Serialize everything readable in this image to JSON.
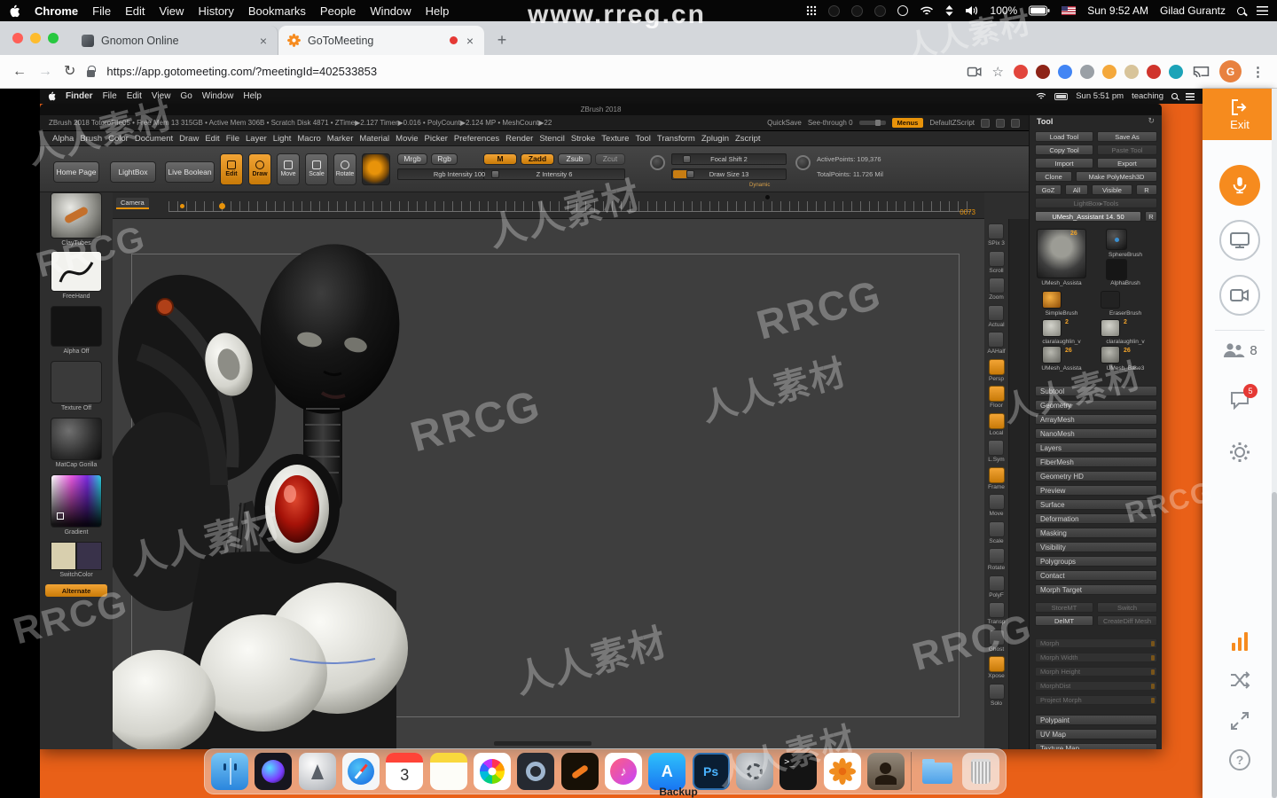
{
  "watermarks": [
    "www.rreg.cn",
    "人人素材",
    "人人素材",
    "RRCG",
    "人人素材",
    "RRCG",
    "人人素材",
    "RRCG",
    "人人素材",
    "RRCG",
    "人人素材",
    "RRCG",
    "人人素材",
    "RRCG",
    "人人素材"
  ],
  "macbar": {
    "app": "Chrome",
    "menus": [
      "File",
      "Edit",
      "View",
      "History",
      "Bookmarks",
      "People",
      "Window",
      "Help"
    ],
    "battery": "100%",
    "clock": "Sun 9:52 AM",
    "user": "Gilad Gurantz"
  },
  "browser": {
    "tab1": "Gnomon Online",
    "tab2": "GoToMeeting",
    "url": "https://app.gotomeeting.com/?meetingId=402533853",
    "avatar": "G",
    "icons": {
      "close": "×",
      "new_tab": "+",
      "back": "←",
      "forward": "→",
      "reload": "↻",
      "star": "☆",
      "menu": "⋮"
    },
    "ext_colors": [
      "#e2453c",
      "#8e2417",
      "#4285f4",
      "#9aa0a6",
      "#f4a83b",
      "#d8c49a",
      "#d0342c",
      "#1ca3b8"
    ]
  },
  "remote": {
    "bar": {
      "app": "Finder",
      "menus": [
        "File",
        "Edit",
        "View",
        "Go",
        "Window",
        "Help"
      ],
      "clock": "Sun 5:51 pm",
      "session": "teaching"
    },
    "desktop_label": "Backup",
    "dock_icons": [
      "finder",
      "siri",
      "launchpad",
      "safari",
      "calendar",
      "notes",
      "photos",
      "quicktime",
      "character-app",
      "itunes",
      "app-store",
      "photoshop",
      "system-preferences",
      "terminal",
      "zbrush",
      "zbrush-sculpt",
      "folder",
      "trash"
    ],
    "dock": {
      "calendar_day": "3",
      "photoshop": "Ps",
      "terminal": ">_",
      "appstore": "A",
      "itunes_glyph": "♪"
    }
  },
  "zbrush": {
    "title": "ZBrush 2018",
    "status_left": "ZBrush 2018 TotoroFile05 • Free Mem 13 315GB • Active Mem 306B • Scratch Disk 4871 • ZTime▶2.127 Timer▶0.016 • PolyCount▶2.124 MP • MeshCount▶22",
    "status_right": {
      "quicksave": "QuickSave",
      "see_through": "See-through 0",
      "menus": "Menus",
      "script": "DefaultZScript"
    },
    "menus": [
      "Alpha",
      "Brush",
      "Color",
      "Document",
      "Draw",
      "Edit",
      "File",
      "Layer",
      "Light",
      "Macro",
      "Marker",
      "Material",
      "Movie",
      "Picker",
      "Preferences",
      "Render",
      "Stencil",
      "Stroke",
      "Texture",
      "Tool",
      "Transform",
      "Zplugin",
      "Zscript"
    ],
    "shelf": {
      "home_page": "Home Page",
      "lightbox": "LightBox",
      "live_boolean": "Live Boolean",
      "edit": "Edit",
      "draw": "Draw",
      "move": "Move",
      "scale": "Scale",
      "rotate": "Rotate",
      "mrgb": "Mrgb",
      "rgb": "Rgb",
      "m": "M",
      "zadd": "Zadd",
      "zsub": "Zsub",
      "zcut": "Zcut",
      "rgb_intensity": "Rgb Intensity 100",
      "z_intensity": "Z Intensity 6",
      "focal_shift": "Focal Shift 2",
      "draw_size": "Draw Size 13",
      "dynamic": "Dynamic",
      "active_points": "ActivePoints: 109,376",
      "total_points": "TotalPoints: 11.726 Mil"
    },
    "timeline": {
      "camera": "Camera",
      "counter": "0073"
    },
    "left_panel": {
      "brush": "ClayTubes",
      "stroke": "FreeHand",
      "alpha": "Alpha Off",
      "texture": "Texture Off",
      "material": "MatCap Gorilla",
      "gradient": "Gradient",
      "switch_color": "SwitchColor",
      "alternate": "Alternate"
    },
    "right_strip": [
      {
        "label": "SPix 3",
        "active": false
      },
      {
        "label": "Scroll",
        "active": false
      },
      {
        "label": "Zoom",
        "active": false
      },
      {
        "label": "Actual",
        "active": false
      },
      {
        "label": "AAHalf",
        "active": false
      },
      {
        "label": "Persp",
        "active": true
      },
      {
        "label": "Floor",
        "active": true
      },
      {
        "label": "Local",
        "active": true
      },
      {
        "label": "L.Sym",
        "active": false
      },
      {
        "label": "Frame",
        "active": true
      },
      {
        "label": "Move",
        "active": false
      },
      {
        "label": "Scale",
        "active": false
      },
      {
        "label": "Rotate",
        "active": false
      },
      {
        "label": "PolyF",
        "active": false
      },
      {
        "label": "Transp",
        "active": false
      },
      {
        "label": "Ghost",
        "active": false
      },
      {
        "label": "Xpose",
        "active": true
      },
      {
        "label": "Solo",
        "active": false
      }
    ],
    "tool": {
      "title": "Tool",
      "load": "Load Tool",
      "save": "Save As",
      "copy": "Copy Tool",
      "paste": "Paste Tool",
      "import": "Import",
      "export": "Export",
      "clone": "Clone",
      "make_polymesh": "Make PolyMesh3D",
      "goz": "GoZ",
      "all": "All",
      "visible": "Visible",
      "r": "R",
      "lightbox_tools": "LightBox▸Tools",
      "current": "UMesh_Assistant 14. 50",
      "current_r": "R",
      "thumbs": {
        "main": {
          "label": "UMesh_Assista",
          "badge": "26"
        },
        "sphere": {
          "label": "SphereBrush"
        },
        "alpha": {
          "label": "AlphaBrush"
        },
        "simple": {
          "label": "SimpleBrush"
        },
        "eraser": {
          "label": "EraserBrush"
        },
        "clara1": {
          "label": "claralaughlin_v",
          "badge": "2"
        },
        "clara2": {
          "label": "claralaughlin_v",
          "badge": "2"
        },
        "umesh1": {
          "label": "UMesh_Assista",
          "badge": "26"
        },
        "umesh2": {
          "label": "UMesh_Base3",
          "badge": "26"
        }
      },
      "sections": [
        "Subtool",
        "Geometry",
        "ArrayMesh",
        "NanoMesh",
        "Layers",
        "FiberMesh",
        "Geometry HD",
        "Preview",
        "Surface",
        "Deformation",
        "Masking",
        "Visibility",
        "Polygroups",
        "Contact",
        "Morph Target"
      ],
      "morph": {
        "store": "StoreMT",
        "switch": "Switch",
        "del": "DelMT",
        "creatediff": "CreateDiff Mesh",
        "sliders": [
          "Morph",
          "Morph Width",
          "Morph Height",
          "MorphDist",
          "Project Morph"
        ]
      },
      "sections_bottom": [
        "Polypaint",
        "UV Map",
        "Texture Map"
      ]
    }
  },
  "gtm": {
    "exit": "Exit",
    "participants": "8",
    "chat_badge": "5",
    "help": "?"
  },
  "colors": {
    "zbrush_accent": "#e8930a",
    "desktop_orange": "#e96018",
    "gtm_orange": "#f68b1e",
    "badge_red": "#e53935"
  }
}
